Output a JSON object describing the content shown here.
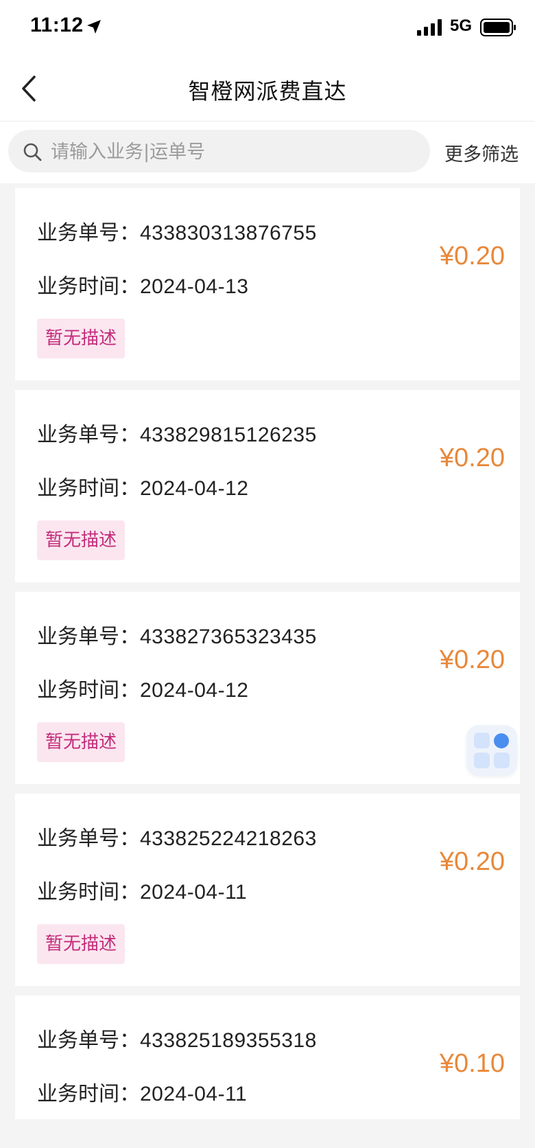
{
  "status_bar": {
    "time": "11:12",
    "network": "5G"
  },
  "nav": {
    "title": "智橙网派费直达"
  },
  "search": {
    "placeholder": "请输入业务|运单号",
    "value": "",
    "filter_label": "更多筛选"
  },
  "records": [
    {
      "order_label": "业务单号：",
      "order_no": "433830313876755",
      "time_label": "业务时间：",
      "date": "2024-04-13",
      "amount": "¥0.20",
      "desc": "暂无描述"
    },
    {
      "order_label": "业务单号：",
      "order_no": "433829815126235",
      "time_label": "业务时间：",
      "date": "2024-04-12",
      "amount": "¥0.20",
      "desc": "暂无描述"
    },
    {
      "order_label": "业务单号：",
      "order_no": "433827365323435",
      "time_label": "业务时间：",
      "date": "2024-04-12",
      "amount": "¥0.20",
      "desc": "暂无描述"
    },
    {
      "order_label": "业务单号：",
      "order_no": "433825224218263",
      "time_label": "业务时间：",
      "date": "2024-04-11",
      "amount": "¥0.20",
      "desc": "暂无描述"
    },
    {
      "order_label": "业务单号：",
      "order_no": "433825189355318",
      "time_label": "业务时间：",
      "date": "2024-04-11",
      "amount": "¥0.10"
    }
  ],
  "colors": {
    "amount": "#e8883a",
    "tag_text": "#c42c7c",
    "tag_bg": "#fbe6ef",
    "float_accent": "#4a8ef0"
  },
  "icons": {
    "back": "chevron-left-icon",
    "search": "search-icon",
    "float": "grid-apps-icon"
  }
}
